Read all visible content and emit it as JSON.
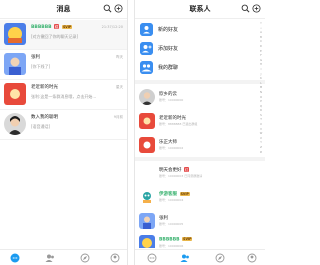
{
  "colors": {
    "accent": "#1c9bf0",
    "green_name": "#3cb371",
    "red_badge": "#e44a4a",
    "svip": "#e8b64a"
  },
  "messages": {
    "title": "消息",
    "icons": {
      "search": "search-icon",
      "add": "plus-circle-icon"
    },
    "items": [
      {
        "name": "BBBBBB",
        "badge": "SVIP",
        "time": "21:37/12:20",
        "preview": "[对方撤回了你的聊天记录]"
      },
      {
        "name": "张利",
        "time": "昨天",
        "preview": "[你下线了]"
      },
      {
        "name": "老近新的时光",
        "time": "星天",
        "preview": "张利:这是一条群消息哦，点击开始..."
      },
      {
        "name": "数入我的聪明",
        "time": "9月前",
        "preview": "[语音通话]"
      }
    ]
  },
  "contacts": {
    "title": "联系人",
    "actions": [
      {
        "label": "新的好友",
        "icon": "user-add-icon"
      },
      {
        "label": "添加好友",
        "icon": "add-friend-icon"
      },
      {
        "label": "我的群聊",
        "icon": "group-icon"
      }
    ],
    "list": [
      {
        "name": "欣乡的云",
        "sub": "账号：10000000"
      },
      {
        "name": "老近新的时光",
        "sub": "账号：8888888 已退出群组"
      },
      {
        "name": "乐正大师",
        "sub": "账号：10000002"
      },
      {
        "name": "明天会更好",
        "badge": "红",
        "sub": "账号：10000003 已同意群邀请"
      },
      {
        "name": "伊游客服",
        "badge": "SVIP",
        "sub": "账号：10000004"
      },
      {
        "name": "张利",
        "sub": "账号：10000005"
      },
      {
        "name": "BBBBBB",
        "badge": "SVIP",
        "sub": "账号：10000006"
      }
    ],
    "alphabet": [
      "↑",
      "☆",
      "A",
      "B",
      "C",
      "D",
      "E",
      "F",
      "G",
      "H",
      "I",
      "J",
      "K",
      "L",
      "M",
      "N",
      "O",
      "P",
      "Q",
      "R",
      "S",
      "T",
      "U",
      "V",
      "W",
      "X",
      "Y",
      "Z",
      "#"
    ]
  }
}
